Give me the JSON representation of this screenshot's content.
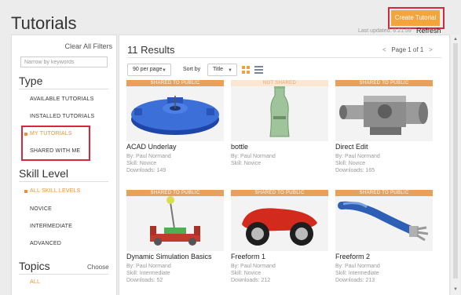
{
  "header": {
    "title": "Tutorials",
    "create_button": "Create Tutorial",
    "last_updated": "Last updated: 6:21:59",
    "refresh": "Refresh"
  },
  "sidebar": {
    "clear_all": "Clear All Filters",
    "search_placeholder": "Narrow by keywords",
    "type": {
      "title": "Type",
      "items": [
        {
          "label": "AVAILABLE TUTORIALS",
          "active": false
        },
        {
          "label": "INSTALLED TUTORIALS",
          "active": false
        },
        {
          "label": "MY TUTORIALS",
          "active": true
        },
        {
          "label": "SHARED WITH ME",
          "active": false
        }
      ]
    },
    "skill": {
      "title": "Skill Level",
      "items": [
        {
          "label": "ALL SKILL LEVELS",
          "active": true
        },
        {
          "label": "NOVICE",
          "active": false
        },
        {
          "label": "INTERMEDIATE",
          "active": false
        },
        {
          "label": "ADVANCED",
          "active": false
        }
      ]
    },
    "topics": {
      "title": "Topics",
      "choose": "Choose",
      "items": [
        {
          "label": "ALL",
          "active": true
        }
      ]
    }
  },
  "main": {
    "results_title": "11 Results",
    "pager": {
      "prev": "<",
      "label": "Page 1 of 1",
      "next": ">"
    },
    "per_page": "90 per page",
    "sort_label": "Sort by",
    "sort_value": "Title",
    "cards": [
      {
        "title": "ACAD Underlay",
        "badge": "SHARED TO PUBLIC",
        "by": "By:  Paul Normand",
        "skill": "Skill:  Novice",
        "downloads": "Downloads:  149"
      },
      {
        "title": "bottle",
        "badge": "NOT SHARED",
        "by": "By:  Paul Normand",
        "skill": "Skill:  Novice",
        "downloads": ""
      },
      {
        "title": "Direct Edit",
        "badge": "SHARED TO PUBLIC",
        "by": "By:  Paul Normand",
        "skill": "Skill:  Novice",
        "downloads": "Downloads:  165"
      },
      {
        "title": "Dynamic Simulation Basics",
        "badge": "SHARED TO PUBLIC",
        "by": "By:  Paul Normand",
        "skill": "Skill:  Intermediate",
        "downloads": "Downloads:  52"
      },
      {
        "title": "Freeform 1",
        "badge": "SHARED TO PUBLIC",
        "by": "By:  Paul Normand",
        "skill": "Skill:  Novice",
        "downloads": "Downloads:  212"
      },
      {
        "title": "Freeform 2",
        "badge": "SHARED TO PUBLIC",
        "by": "By:  Paul Normand",
        "skill": "Skill:  Intermediate",
        "downloads": "Downloads:  213"
      }
    ]
  },
  "colors": {
    "accent": "#f0922b",
    "button": "#f3a43a",
    "highlight": "#d6283c",
    "badge_public": "#e9a05a"
  }
}
